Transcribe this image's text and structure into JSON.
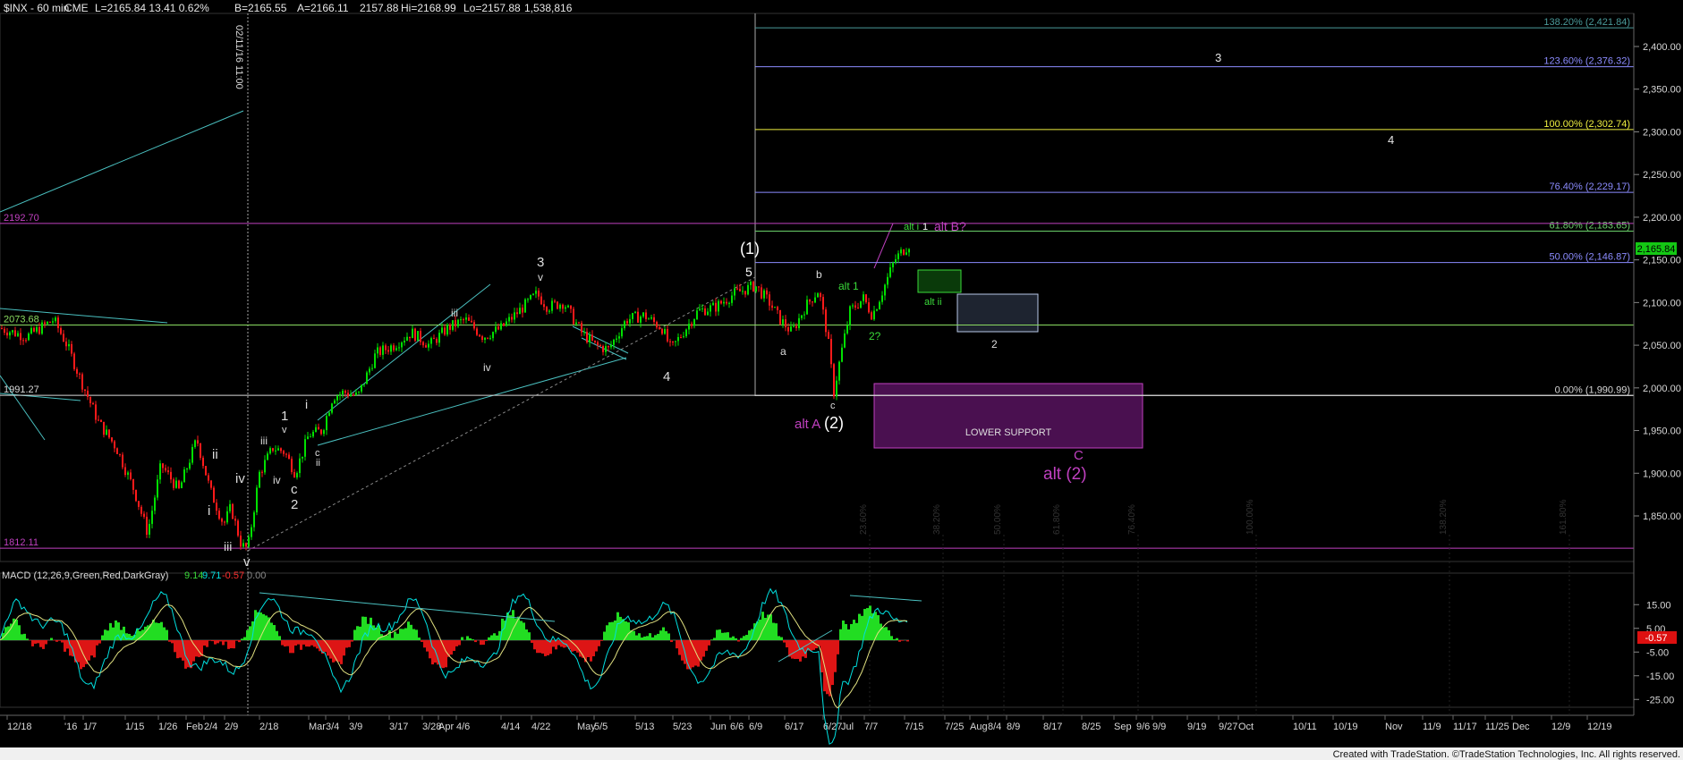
{
  "header": {
    "symbol": "$INX - 60 min",
    "exchange": "CME",
    "quote": "L=2165.84  13.41  0.62%",
    "bid": "B=2165.55",
    "ask": "A=2166.11",
    "last2": "2157.88",
    "hi": "Hi=2168.99",
    "lo": "Lo=2157.88",
    "vol": "1,538,816"
  },
  "date_marker": "02/11/16 11:00",
  "price_axis": {
    "ticks": [
      "2,400.00",
      "2,350.00",
      "2,300.00",
      "2,250.00",
      "2,200.00",
      "2,150.00",
      "2,100.00",
      "2,050.00",
      "2,000.00",
      "1,950.00",
      "1,900.00",
      "1,850.00"
    ],
    "last_label": "2,165.84"
  },
  "macd": {
    "label": "MACD (12,26,9,Green,Red,DarkGray)",
    "val1": "9.14",
    "val2": "9.71",
    "val3": "-0.57",
    "val4": "0.00",
    "ticks": [
      "15.00",
      "5.00",
      "-5.00",
      "-15.00",
      "-25.00"
    ],
    "last_label": "-0.57"
  },
  "x_axis": [
    "12/18",
    "'16",
    "1/7",
    "1/15",
    "1/26",
    "Feb",
    "2/4",
    "2/9",
    "2/18",
    "Mar",
    "3/4",
    "3/9",
    "3/17",
    "3/28",
    "Apr",
    "4/6",
    "4/14",
    "4/22",
    "May",
    "5/5",
    "5/13",
    "5/23",
    "Jun",
    "6/6",
    "6/9",
    "6/17",
    "6/27",
    "Jul",
    "7/7",
    "7/15",
    "7/25",
    "Aug",
    "8/4",
    "8/9",
    "8/17",
    "8/25",
    "Sep",
    "9/6",
    "9/9",
    "9/19",
    "9/27",
    "Oct",
    "10/11",
    "10/19",
    "Nov",
    "11/9",
    "11/17",
    "11/25",
    "Dec",
    "12/9",
    "12/19"
  ],
  "fib_levels": [
    {
      "label": "138.20% (2,421.84)",
      "color": "#4a9a9a"
    },
    {
      "label": "123.60% (2,376.32)",
      "color": "#8c8cff"
    },
    {
      "label": "100.00% (2,302.74)",
      "color": "#f0f040"
    },
    {
      "label": "76.40% (2,229.17)",
      "color": "#8c8cff"
    },
    {
      "label": "61.80% (2,183.65)",
      "color": "#6ad06a"
    },
    {
      "label": "50.00% (2,146.87)",
      "color": "#8c8cff"
    },
    {
      "label": "0.00% (1,990.99)",
      "color": "#d8d8d8"
    }
  ],
  "levels": [
    {
      "label": "2192.70",
      "color": "#c040c0"
    },
    {
      "label": "2073.68",
      "color": "#8adb60"
    },
    {
      "label": "1991.27",
      "color": "#d8d8d8"
    },
    {
      "label": "1812.11",
      "color": "#c040c0"
    }
  ],
  "time_fibs": [
    "23.60%",
    "38.20%",
    "50.00%",
    "61.80%",
    "76.40%",
    "100.00%",
    "138.20%",
    "161.80%"
  ],
  "boxes": {
    "lower_support": "LOWER SUPPORT"
  },
  "wave_labels": {
    "w3_top": "3",
    "w4_top": "4",
    "alt_i1": "alt i",
    "one": "1",
    "alt_b": "alt B?",
    "paren1": "(1)",
    "five": "5",
    "b": "b",
    "alt1": "alt 1",
    "alt_ii": "alt ii",
    "a": "a",
    "two_q": "2?",
    "two": "2",
    "c_small": "c",
    "alt_a": "alt A",
    "paren2": "(2)",
    "C": "C",
    "alt_paren2": "alt (2)",
    "three": "3",
    "v_small": "v",
    "iii_small": "iii",
    "iv_small": "iv",
    "four": "4",
    "i": "i",
    "one_b": "1",
    "v2": "v",
    "iii2": "iii",
    "iv2": "iv",
    "c2": "c",
    "two_b": "2",
    "ii_small": "ii",
    "c3": "c",
    "ii": "ii",
    "iv": "iv",
    "i_low": "i",
    "iii_low": "iii",
    "v_low": "v"
  },
  "footer": "Created with TradeStation. ©TradeStation Technologies, Inc. All rights reserved.",
  "colors": {
    "up": "#00e000",
    "down": "#ff1a1a",
    "macd_line": "#00e0e0",
    "signal": "#e0e080"
  }
}
